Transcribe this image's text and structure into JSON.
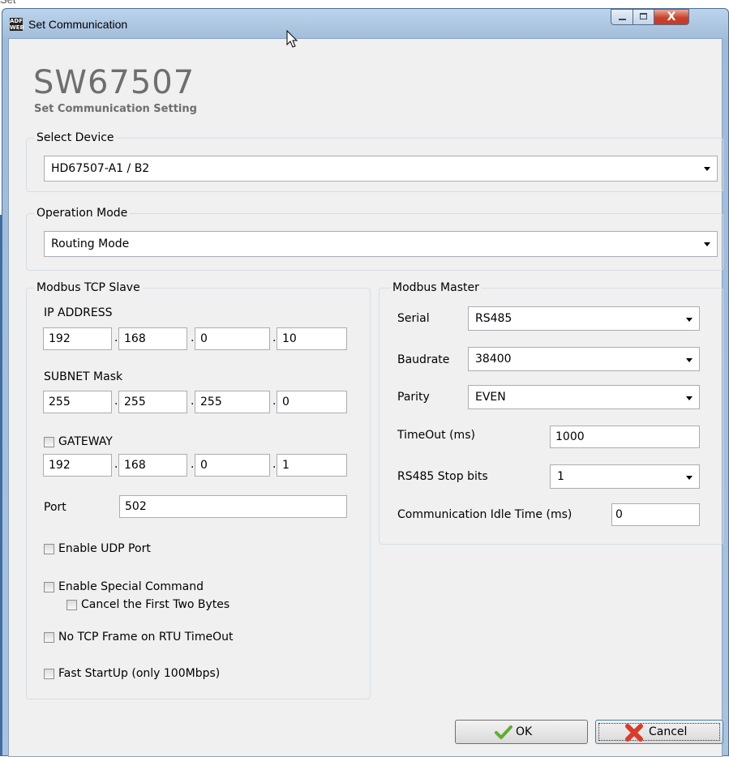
{
  "window": {
    "title": "Set Communication",
    "app_icon_text": "ADF WEB",
    "controls": {
      "minimize": "minimize",
      "maximize": "maximize",
      "close": "X"
    }
  },
  "header": {
    "product": "SW67507",
    "subtitle": "Set Communication Setting"
  },
  "select_device": {
    "legend": "Select Device",
    "value": "HD67507-A1 / B2"
  },
  "operation_mode": {
    "legend": "Operation Mode",
    "value": "Routing Mode"
  },
  "tcp_slave": {
    "legend": "Modbus TCP Slave",
    "ip_label": "IP ADDRESS",
    "ip": [
      "192",
      "168",
      "0",
      "10"
    ],
    "subnet_label": "SUBNET Mask",
    "subnet": [
      "255",
      "255",
      "255",
      "0"
    ],
    "gateway_label": "GATEWAY",
    "gateway_checked": false,
    "gateway": [
      "192",
      "168",
      "0",
      "1"
    ],
    "port_label": "Port",
    "port": "502",
    "udp_label": "Enable UDP Port",
    "special_label": "Enable Special Command",
    "cancel_bytes_label": "Cancel the First Two Bytes",
    "no_tcp_label": "No TCP Frame on RTU TimeOut",
    "fast_label": "Fast StartUp (only 100Mbps)"
  },
  "modbus_master": {
    "legend": "Modbus Master",
    "serial_label": "Serial",
    "serial": "RS485",
    "baud_label": "Baudrate",
    "baud": "38400",
    "parity_label": "Parity",
    "parity": "EVEN",
    "timeout_label": "TimeOut (ms)",
    "timeout": "1000",
    "stopbits_label": "RS485 Stop bits",
    "stopbits": "1",
    "idle_label": "Communication Idle Time (ms)",
    "idle": "0"
  },
  "buttons": {
    "ok": "OK",
    "cancel": "Cancel"
  },
  "colors": {
    "ok_check": "#5fae2f",
    "cancel_x": "#d83c2a",
    "group_border": "#d5dfe5"
  }
}
